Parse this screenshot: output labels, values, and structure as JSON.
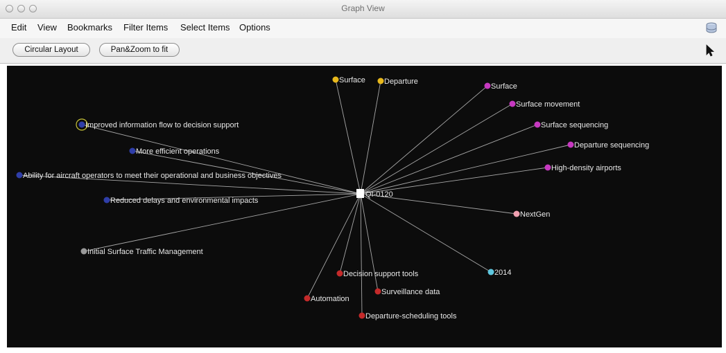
{
  "window": {
    "title": "Graph View"
  },
  "menu": {
    "edit": "Edit",
    "view": "View",
    "bookmarks": "Bookmarks",
    "filter_items": "Filter Items",
    "select_items": "Select Items",
    "options": "Options"
  },
  "toolbar": {
    "circular_layout": "Circular Layout",
    "pan_zoom": "Pan&Zoom to fit"
  },
  "graph": {
    "colors": {
      "blue": "#2f3ea8",
      "yellow": "#e8b81c",
      "magenta": "#c639c0",
      "pink": "#f0a0b0",
      "cyan": "#5fc8e0",
      "red": "#c42a2a",
      "gray": "#9a9a9a",
      "center": "#ffffff",
      "edge": "#a8a8a8",
      "background": "#0c0c0c"
    },
    "center": {
      "label": "QI-0120"
    },
    "nodes": [
      {
        "label": "Surface",
        "color": "yellow"
      },
      {
        "label": "Departure",
        "color": "yellow"
      },
      {
        "label": "Surface",
        "color": "magenta"
      },
      {
        "label": "Surface movement",
        "color": "magenta"
      },
      {
        "label": "Surface sequencing",
        "color": "magenta"
      },
      {
        "label": "Departure sequencing",
        "color": "magenta"
      },
      {
        "label": "High-density airports",
        "color": "magenta"
      },
      {
        "label": "NextGen",
        "color": "pink"
      },
      {
        "label": "2014",
        "color": "cyan"
      },
      {
        "label": "Decision support tools",
        "color": "red"
      },
      {
        "label": "Surveillance data",
        "color": "red"
      },
      {
        "label": "Automation",
        "color": "red"
      },
      {
        "label": "Departure-scheduling tools",
        "color": "red"
      },
      {
        "label": "Improved information flow to decision support",
        "color": "blue",
        "selected": true
      },
      {
        "label": "More efficient operations",
        "color": "blue"
      },
      {
        "label": "Ability for aircraft operators to meet their operational and business objectives",
        "color": "blue"
      },
      {
        "label": "Reduced delays and environmental impacts",
        "color": "blue"
      },
      {
        "label": "Initial Surface Traffic Management",
        "color": "gray"
      }
    ]
  }
}
